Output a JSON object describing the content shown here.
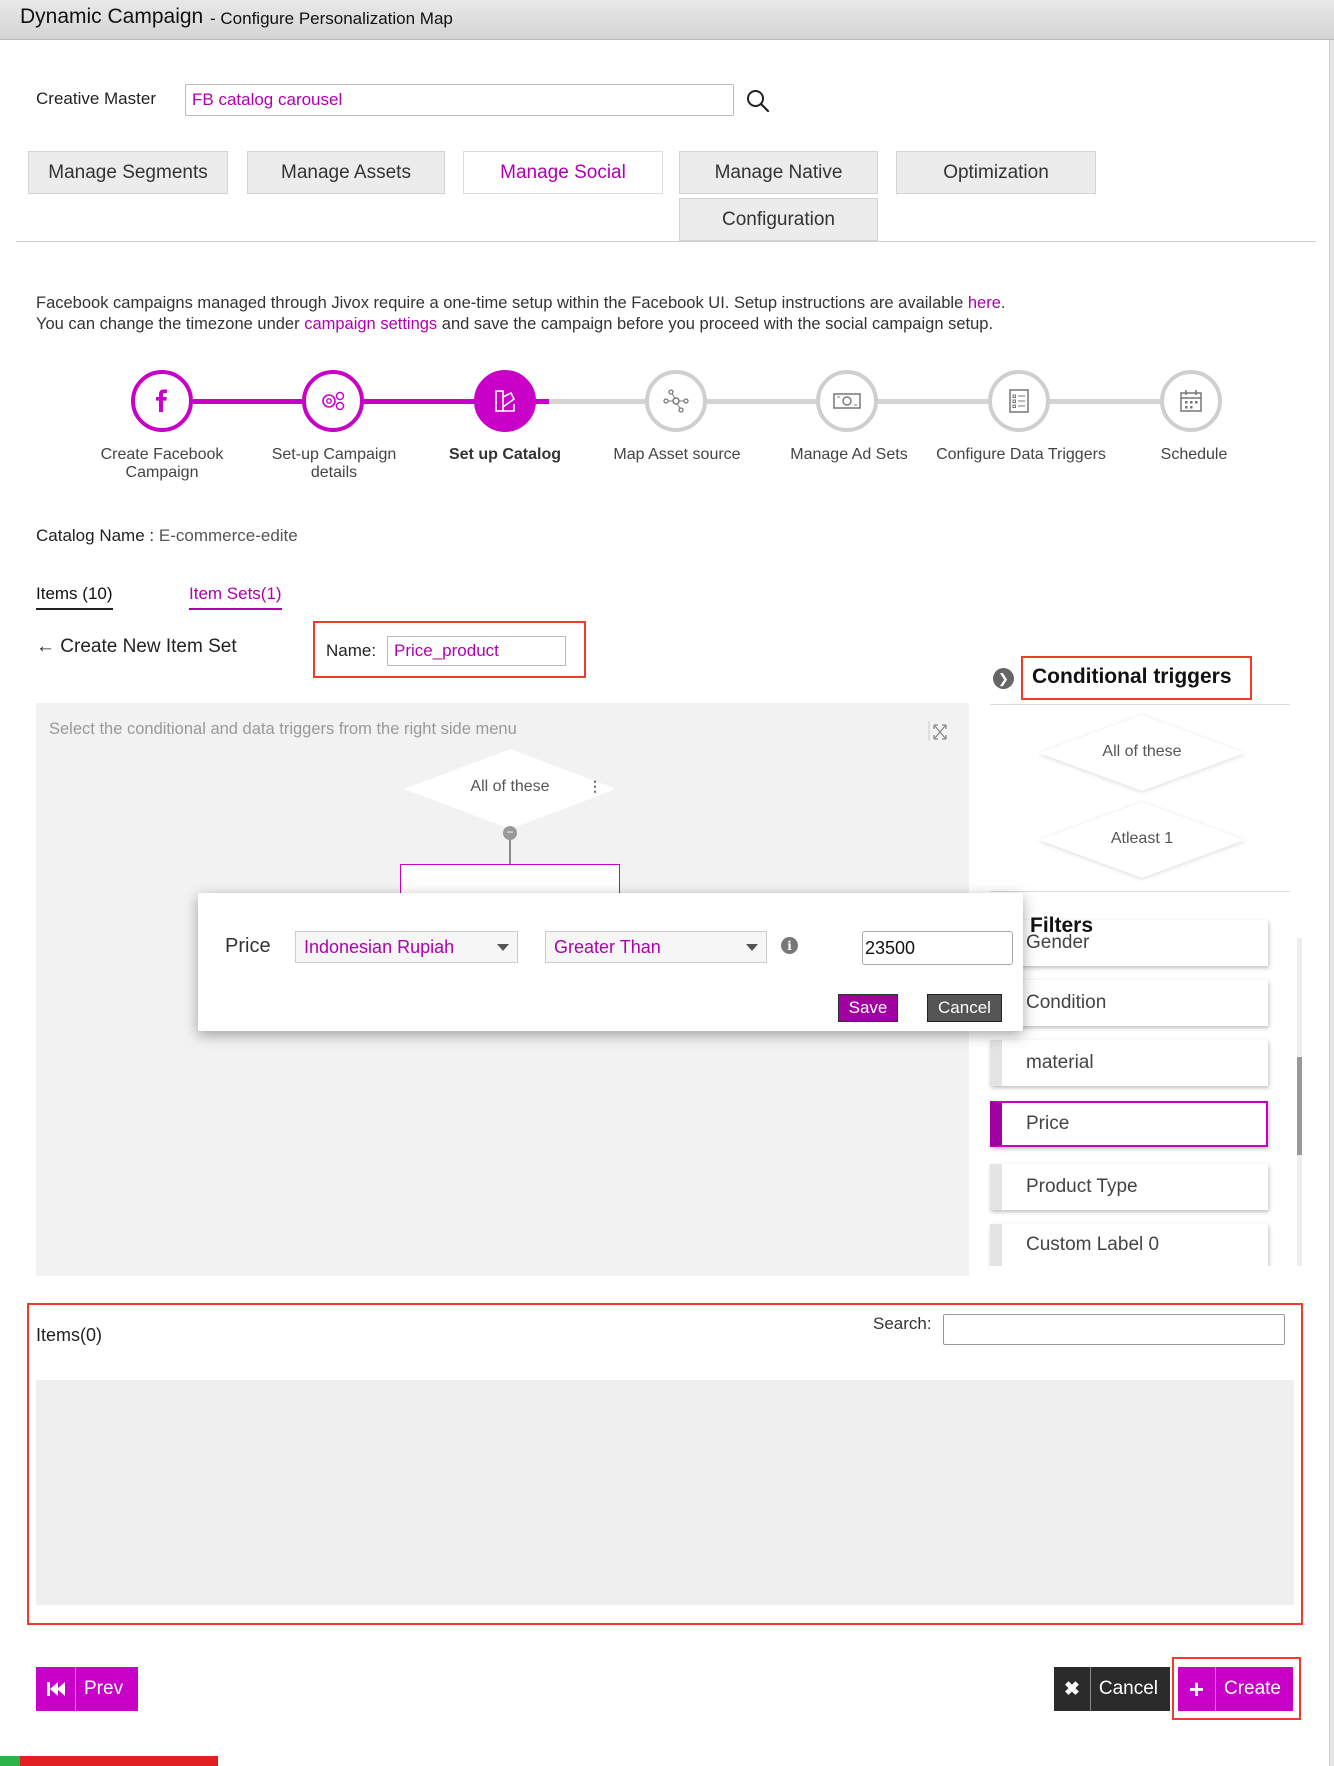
{
  "header": {
    "title": "Dynamic Campaign",
    "subtitle": "- Configure Personalization Map"
  },
  "creative_master": {
    "label": "Creative Master",
    "value": "FB catalog carousel"
  },
  "tabs": [
    {
      "label": "Manage Segments"
    },
    {
      "label": "Manage Assets"
    },
    {
      "label": "Manage Social"
    },
    {
      "label": "Manage Native"
    },
    {
      "label": "Optimization"
    },
    {
      "label": "Configuration"
    }
  ],
  "info": {
    "line1_prefix": "Facebook campaigns managed through Jivox require a one-time setup within the Facebook UI. Setup instructions are available ",
    "line1_link": "here",
    "line1_suffix": ".",
    "line2_prefix": "You can change the timezone under ",
    "line2_link": "campaign settings",
    "line2_suffix": " and save the campaign before you proceed with the social campaign setup."
  },
  "steps": [
    {
      "label": "Create Facebook Campaign",
      "icon": "facebook-icon"
    },
    {
      "label": "Set-up Campaign details",
      "icon": "gears-icon"
    },
    {
      "label": "Set up Catalog",
      "icon": "catalog-icon"
    },
    {
      "label": "Map Asset source",
      "icon": "network-icon"
    },
    {
      "label": "Manage Ad Sets",
      "icon": "money-icon"
    },
    {
      "label": "Configure Data Triggers",
      "icon": "checklist-icon"
    },
    {
      "label": "Schedule",
      "icon": "calendar-icon"
    }
  ],
  "catalog": {
    "label": "Catalog Name :",
    "value": "E-commerce-edite"
  },
  "subtabs": {
    "items": "Items (10)",
    "item_sets": "Item Sets(1)"
  },
  "create_new": "Create New Item Set",
  "name_field": {
    "label": "Name:",
    "value": "Price_product"
  },
  "canvas": {
    "hint": "Select the conditional and data triggers from the right side menu",
    "node_label": "All of these"
  },
  "conditional_triggers": {
    "title": "Conditional triggers",
    "options": [
      "All of these",
      "Atleast 1"
    ]
  },
  "filters": {
    "title": "Filters",
    "items": [
      "Gender",
      "Condition",
      "material",
      "Price",
      "Product Type",
      "Custom Label 0"
    ]
  },
  "popup": {
    "field": "Price",
    "currency": "Indonesian Rupiah",
    "operator": "Greater Than",
    "value": "23500",
    "save": "Save",
    "cancel": "Cancel"
  },
  "items_panel": {
    "title": "Items(0)",
    "search_label": "Search:"
  },
  "footer": {
    "prev": "Prev",
    "cancel": "Cancel",
    "create": "Create"
  },
  "colors": {
    "accent": "#c800c8",
    "highlight_border": "#ee3b2a"
  }
}
